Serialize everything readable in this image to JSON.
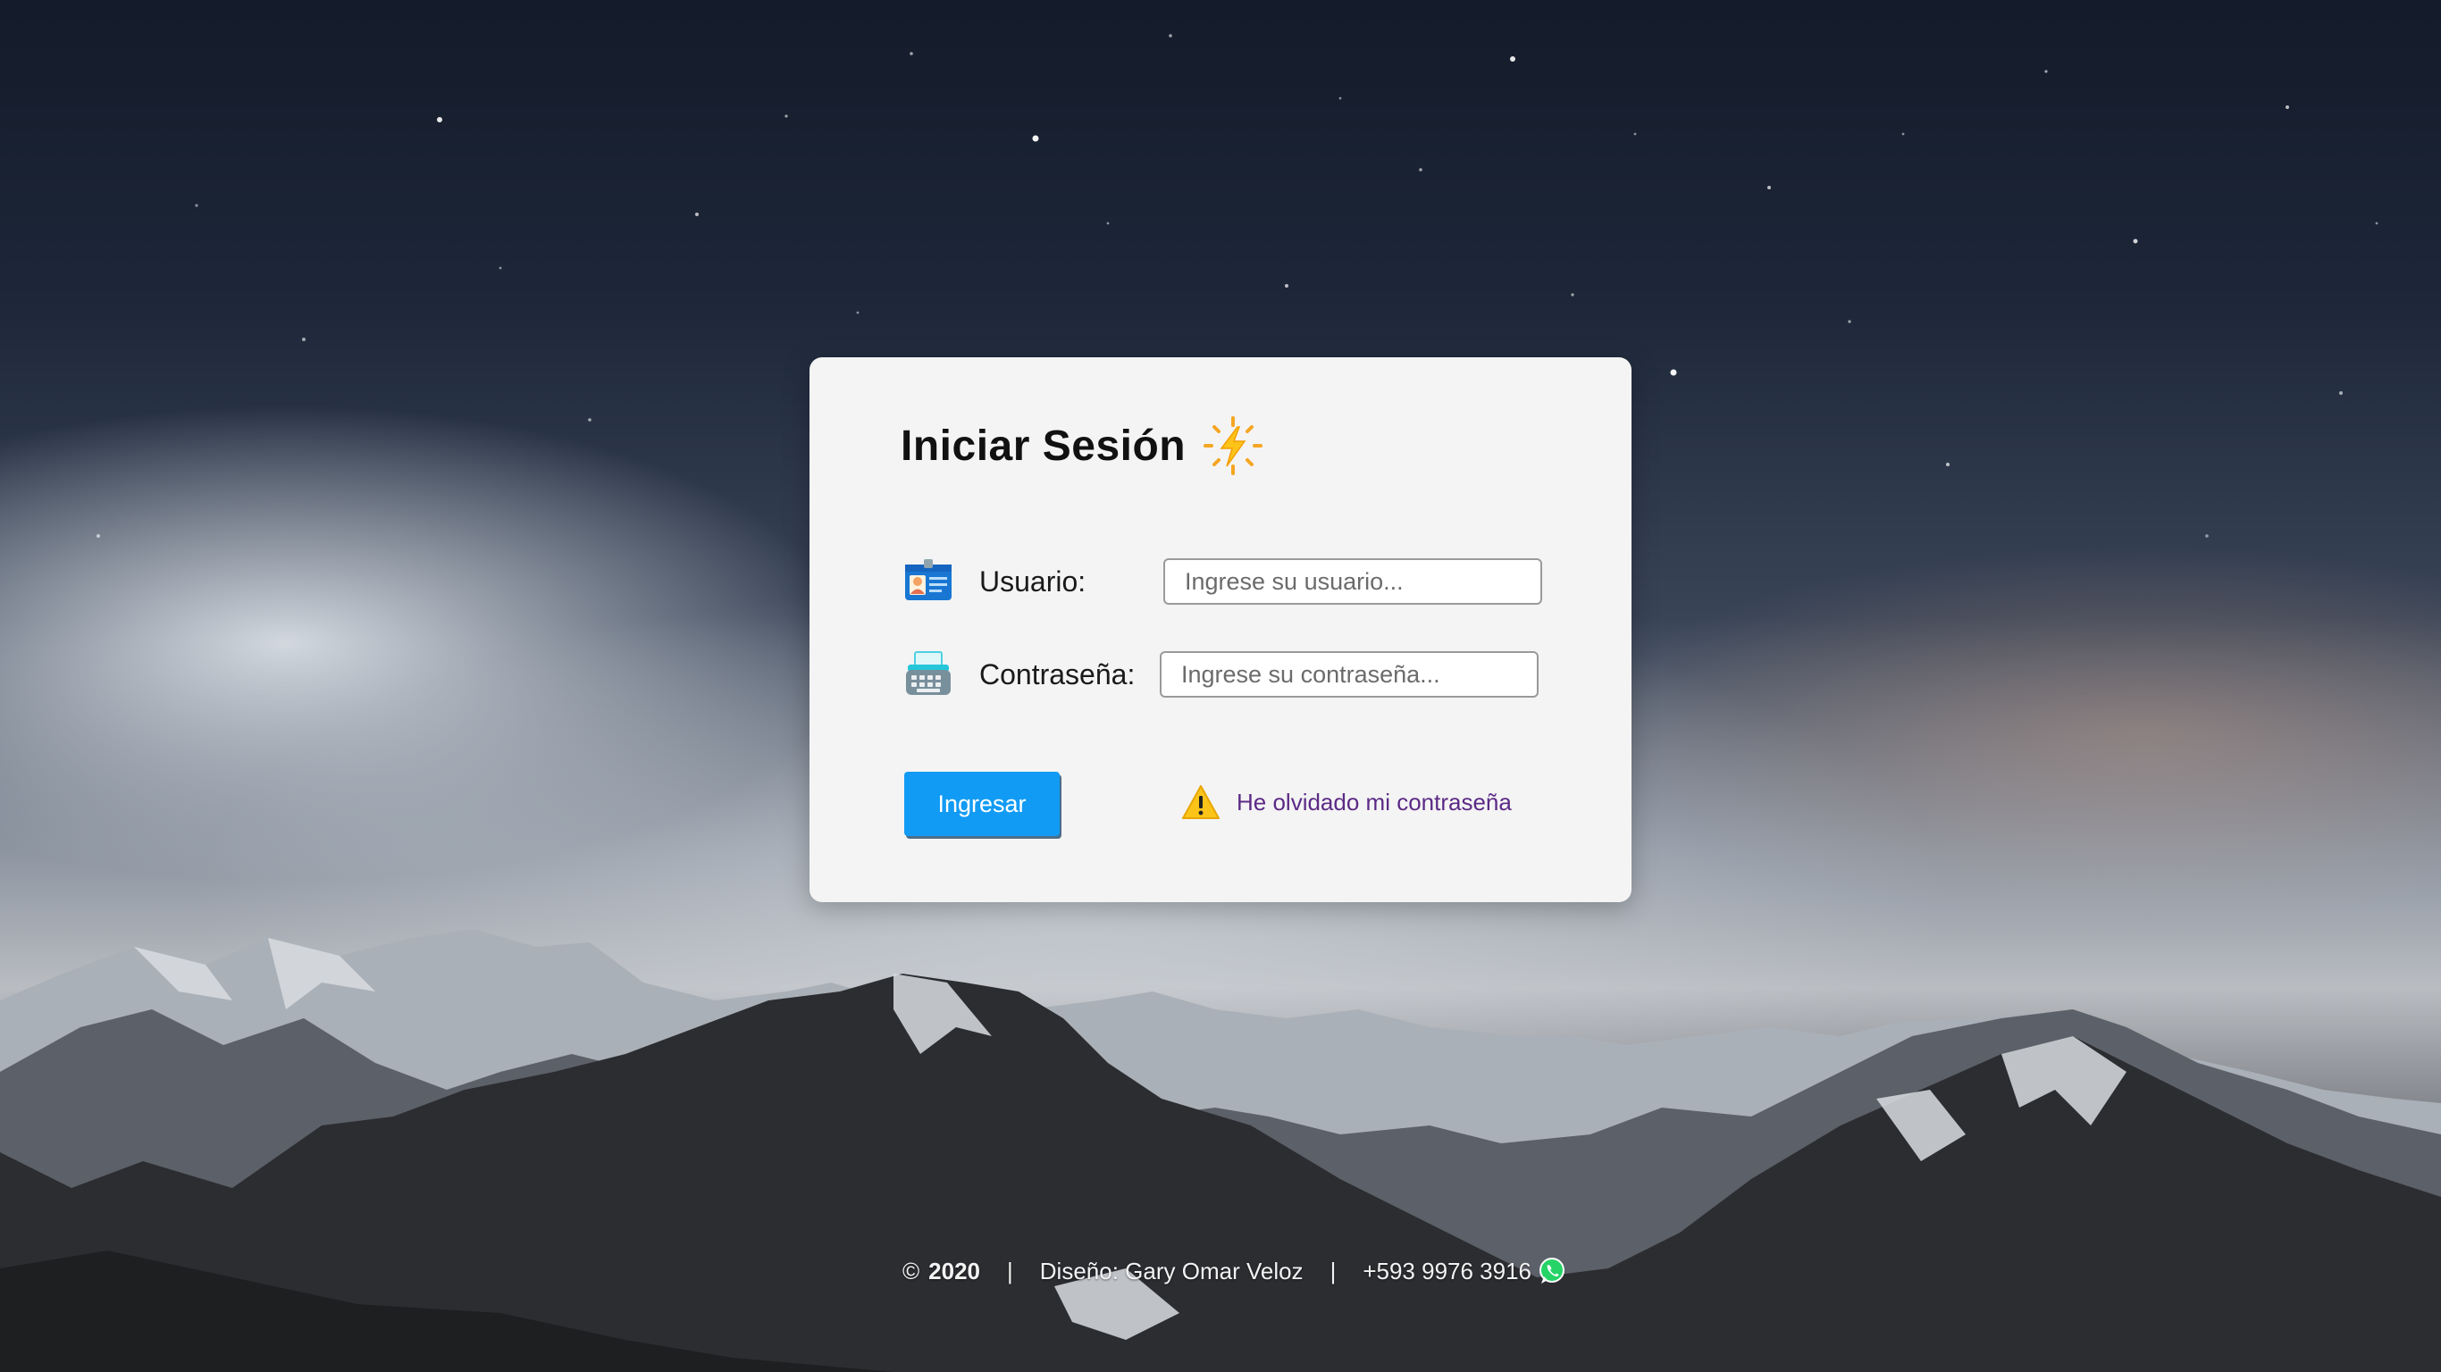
{
  "login": {
    "title": "Iniciar Sesión",
    "title_icon": "sparkle-lightning-icon",
    "user_label": "Usuario:",
    "user_icon": "id-card-icon",
    "user_placeholder": "Ingrese su usuario...",
    "user_value": "",
    "password_label": "Contraseña:",
    "password_icon": "typewriter-icon",
    "password_placeholder": "Ingrese su contraseña...",
    "password_value": "",
    "submit_label": "Ingresar",
    "forgot_icon": "warning-icon",
    "forgot_label": "He olvidado mi contraseña"
  },
  "footer": {
    "copyright_symbol": "©",
    "year": "2020",
    "separator": "|",
    "design_credit": "Diseño: Gary Omar Veloz",
    "phone": "+593 9976 3916",
    "phone_icon": "whatsapp-icon"
  },
  "colors": {
    "card_bg": "#f4f4f4",
    "button_bg": "#129bf4",
    "link_color": "#5b2a86"
  }
}
